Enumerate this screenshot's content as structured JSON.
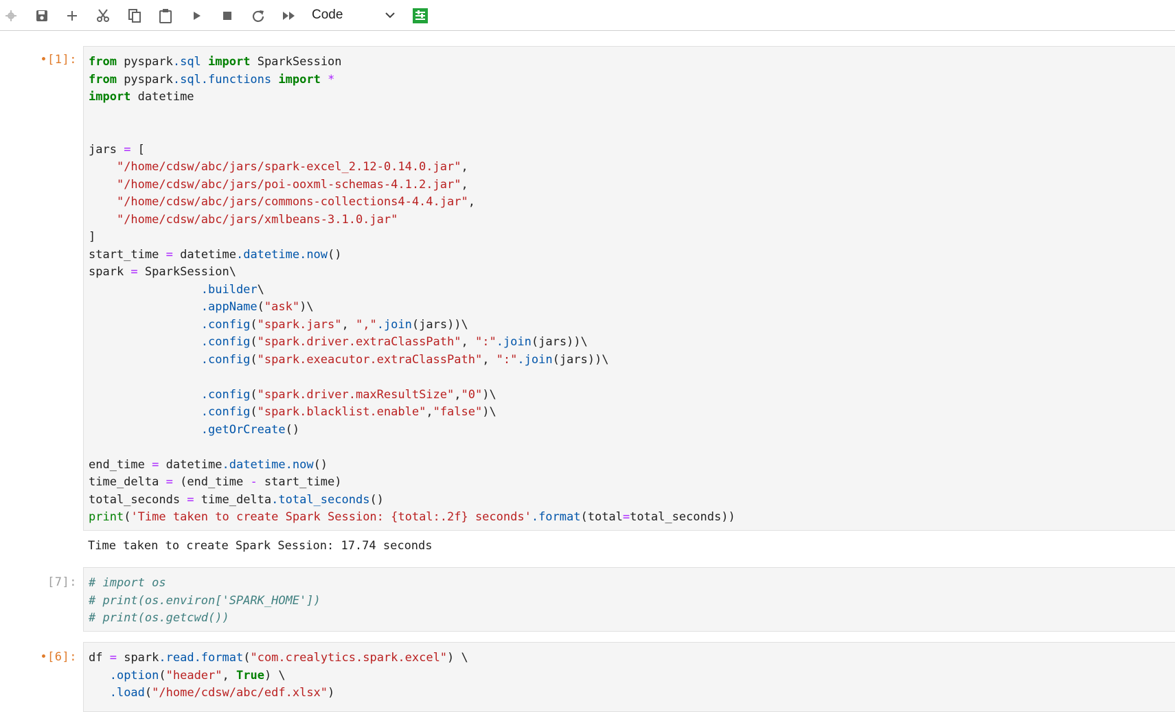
{
  "toolbar": {
    "kernel_type": "Code",
    "icons": [
      "gear-icon",
      "save-icon",
      "add-icon",
      "cut-icon",
      "copy-icon",
      "paste-icon",
      "run-icon",
      "stop-icon",
      "restart-icon",
      "fast-forward-icon",
      "property-inspector-icon"
    ]
  },
  "colors": {
    "keyword": "#008000",
    "string": "#ba2121",
    "attribute": "#0055aa",
    "operator": "#aa22ff",
    "comment": "#408080",
    "dirty_prompt": "#e07b2a",
    "accent_green": "#22a33a"
  },
  "cells": [
    {
      "prompt": "•[1]:",
      "lines": [
        "from pyspark.sql import SparkSession",
        "from pyspark.sql.functions import *",
        "import datetime",
        "",
        "",
        "jars = [",
        "    \"/home/cdsw/abc/jars/spark-excel_2.12-0.14.0.jar\",",
        "    \"/home/cdsw/abc/jars/poi-ooxml-schemas-4.1.2.jar\",",
        "    \"/home/cdsw/abc/jars/commons-collections4-4.4.jar\",",
        "    \"/home/cdsw/abc/jars/xmlbeans-3.1.0.jar\"",
        "]",
        "start_time = datetime.datetime.now()",
        "spark = SparkSession\\",
        "                .builder\\",
        "                .appName(\"ask\")\\",
        "                .config(\"spark.jars\", \",\".join(jars))\\",
        "                .config(\"spark.driver.extraClassPath\", \":\".join(jars))\\",
        "                .config(\"spark.exeacutor.extraClassPath\", \":\".join(jars))\\",
        "",
        "                .config(\"spark.driver.maxResultSize\",\"0\")\\",
        "                .config(\"spark.blacklist.enable\",\"false\")\\",
        "                .getOrCreate()",
        "",
        "end_time = datetime.datetime.now()",
        "time_delta = (end_time - start_time)",
        "total_seconds = time_delta.total_seconds()",
        "print('Time taken to create Spark Session: {total:.2f} seconds'.format(total=total_seconds))"
      ],
      "output": "Time taken to create Spark Session: 17.74 seconds"
    },
    {
      "prompt": "[7]:",
      "lines": [
        "# import os",
        "# print(os.environ['SPARK_HOME'])",
        "# print(os.getcwd())"
      ]
    },
    {
      "prompt": "•[6]:",
      "lines": [
        "df = spark.read.format(\"com.crealytics.spark.excel\") \\",
        "   .option(\"header\", True) \\",
        "   .load(\"/home/cdsw/abc/edf.xlsx\")"
      ]
    }
  ]
}
